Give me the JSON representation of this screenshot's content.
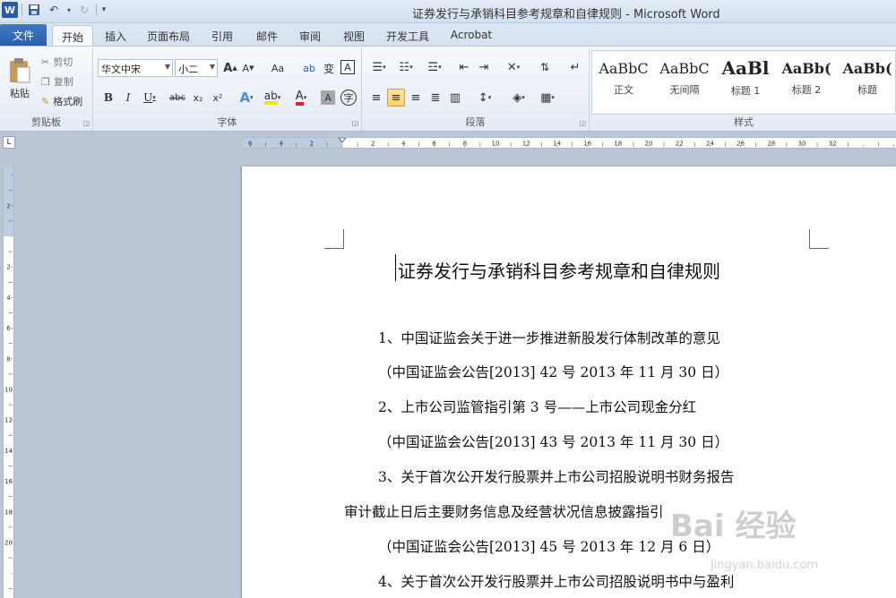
{
  "window": {
    "title": "证券发行与承销科目参考规章和自律规则 - Microsoft Word",
    "app_icon": "W"
  },
  "tabs": [
    "文件",
    "开始",
    "插入",
    "页面布局",
    "引用",
    "邮件",
    "审阅",
    "视图",
    "开发工具",
    "Acrobat"
  ],
  "clipboard": {
    "paste": "粘贴",
    "cut": "剪切",
    "copy": "复制",
    "format_painter": "格式刷",
    "label": "剪贴板"
  },
  "font": {
    "name": "华文中宋",
    "size": "小二",
    "label": "字体",
    "grow": "A",
    "shrink": "A",
    "change_case": "Aa",
    "bold": "B",
    "italic": "I",
    "underline": "U",
    "strike": "abc",
    "subscript": "x₂",
    "superscript": "x²"
  },
  "paragraph": {
    "label": "段落"
  },
  "styles": {
    "label": "样式",
    "items": [
      {
        "sample": "AaBbC",
        "name": "正文"
      },
      {
        "sample": "AaBbC",
        "name": "无间隔"
      },
      {
        "sample": "AaBl",
        "name": "标题 1"
      },
      {
        "sample": "AaBb(",
        "name": "标题 2"
      },
      {
        "sample": "AaBb(",
        "name": "标题"
      }
    ]
  },
  "ruler": {
    "corner": "L",
    "h_ticks": [
      "6",
      "4",
      "2",
      "2",
      "4",
      "6",
      "8",
      "10",
      "12",
      "14",
      "16",
      "18",
      "20",
      "22",
      "24",
      "26",
      "28",
      "30",
      "32"
    ],
    "v_ticks": [
      "2",
      "2",
      "4",
      "6",
      "8",
      "10",
      "12",
      "14",
      "16",
      "18",
      "20"
    ]
  },
  "document": {
    "title": "证券发行与承销科目参考规章和自律规则",
    "lines": [
      "1、中国证监会关于进一步推进新股发行体制改革的意见",
      "（中国证监会公告[2013] 42 号    2013 年 11 月 30 日）",
      "2、上市公司监管指引第 3 号——上市公司现金分红",
      "（中国证监会公告[2013] 43 号    2013 年 11 月 30 日）",
      "3、关于首次公开发行股票并上市公司招股说明书财务报告",
      "审计截止日后主要财务信息及经营状况信息披露指引",
      "（中国证监会公告[2013] 45 号    2013 年 12 月 6 日）",
      "4、关于首次公开发行股票并上市公司招股说明书中与盈利"
    ]
  },
  "watermark": {
    "text": "Bai 经验",
    "sub": "jingyan.baidu.com"
  }
}
